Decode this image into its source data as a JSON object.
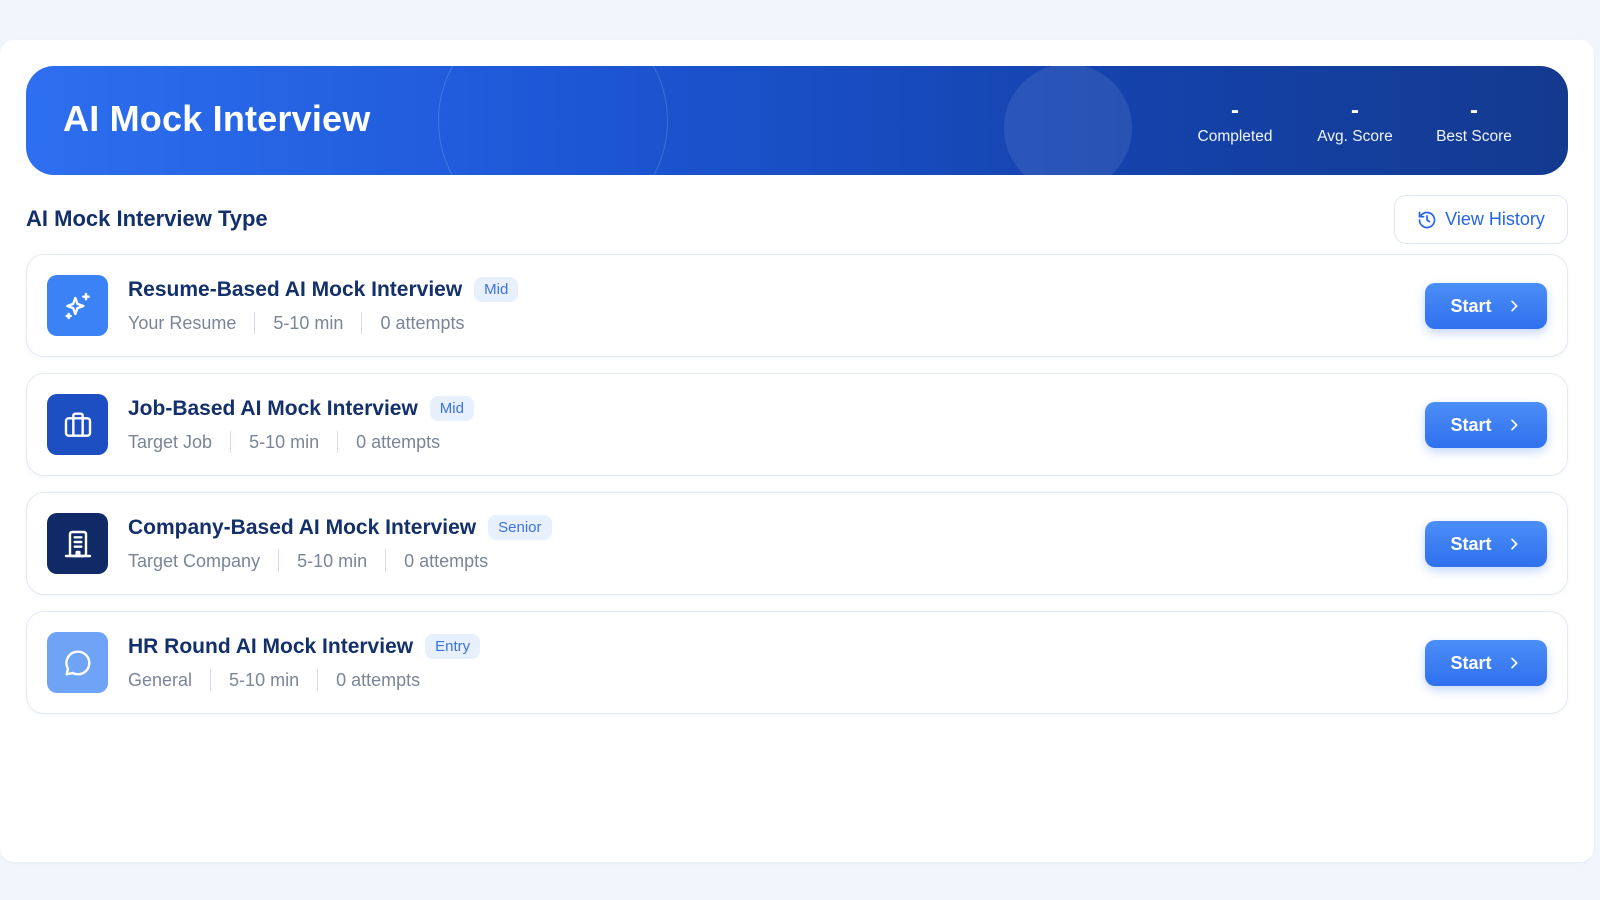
{
  "header": {
    "title": "AI Mock Interview",
    "stats": [
      {
        "value": "-",
        "label": "Completed"
      },
      {
        "value": "-",
        "label": "Avg. Score"
      },
      {
        "value": "-",
        "label": "Best Score"
      }
    ]
  },
  "section": {
    "title": "AI Mock Interview Type",
    "history_button": "View History",
    "history_icon": "history-icon"
  },
  "interviews": [
    {
      "title": "Resume-Based AI Mock Interview",
      "level": "Mid",
      "source": "Your Resume",
      "duration": "5-10 min",
      "attempts": "0 attempts",
      "icon": "sparkle-icon",
      "icon_color": "#3b82f6",
      "start_label": "Start"
    },
    {
      "title": "Job-Based AI Mock Interview",
      "level": "Mid",
      "source": "Target Job",
      "duration": "5-10 min",
      "attempts": "0 attempts",
      "icon": "briefcase-icon",
      "icon_color": "#1e4fc2",
      "start_label": "Start"
    },
    {
      "title": "Company-Based AI Mock Interview",
      "level": "Senior",
      "source": "Target Company",
      "duration": "5-10 min",
      "attempts": "0 attempts",
      "icon": "building-icon",
      "icon_color": "#0f2a66",
      "start_label": "Start"
    },
    {
      "title": "HR Round AI Mock Interview",
      "level": "Entry",
      "source": "General",
      "duration": "5-10 min",
      "attempts": "0 attempts",
      "icon": "chat-icon",
      "icon_color": "#6ea3f5",
      "start_label": "Start"
    }
  ],
  "colors": {
    "accent": "#2f70ee",
    "heading": "#13306a",
    "muted": "#7a8597"
  }
}
